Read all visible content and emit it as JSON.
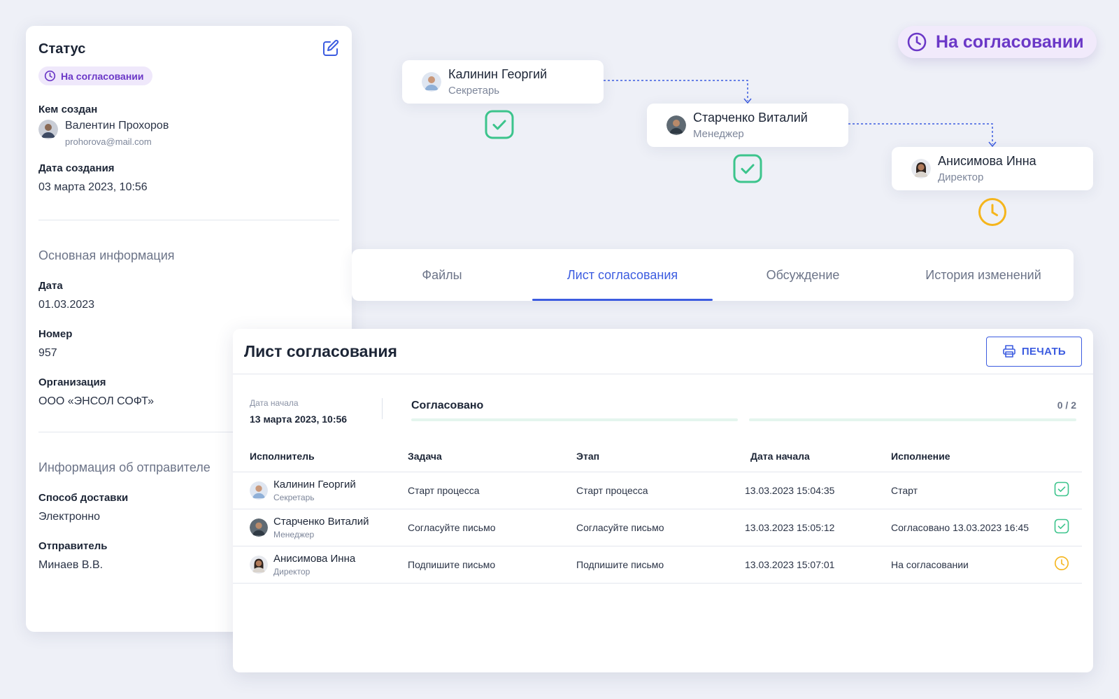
{
  "info": {
    "title": "Статус",
    "status_badge": "На согласовании",
    "created_by_label": "Кем создан",
    "creator_name": "Валентин Прохоров",
    "creator_email": "prohorova@mail.com",
    "created_date_label": "Дата создания",
    "created_date": "03 марта 2023, 10:56",
    "main_section": "Основная информация",
    "date_label": "Дата",
    "date": "01.03.2023",
    "number_label": "Номер",
    "number": "957",
    "org_label": "Организация",
    "org": "ООО «ЭНСОЛ СОФТ»",
    "sender_section": "Информация об отправителе",
    "delivery_label": "Способ доставки",
    "delivery": "Электронно",
    "sender_label": "Отправитель",
    "sender": "Минаев В.В."
  },
  "status_pill": "На согласовании",
  "workflow": [
    {
      "name": "Калинин Георгий",
      "role": "Секретарь",
      "state": "done"
    },
    {
      "name": "Старченко Виталий",
      "role": "Менеджер",
      "state": "done"
    },
    {
      "name": "Анисимова Инна",
      "role": "Директор",
      "state": "pending"
    }
  ],
  "tabs": [
    "Файлы",
    "Лист согласования",
    "Обсуждение",
    "История изменений"
  ],
  "active_tab": "Лист согласования",
  "sheet": {
    "title": "Лист согласования",
    "print_label": "ПЕЧАТЬ",
    "start_date_label": "Дата начала",
    "start_date": "13 марта 2023, 10:56",
    "approved_label": "Согласовано",
    "approved_count": "0 / 2",
    "columns": [
      "Исполнитель",
      "Задача",
      "Этап",
      "Дата начала",
      "Исполнение"
    ],
    "rows": [
      {
        "name": "Калинин Георгий",
        "role": "Секретарь",
        "task": "Старт процесса",
        "stage": "Старт процесса",
        "date": "13.03.2023  15:04:35",
        "result": "Старт",
        "state": "done"
      },
      {
        "name": "Старченко Виталий",
        "role": "Менеджер",
        "task": "Согласуйте письмо",
        "stage": "Согласуйте письмо",
        "date": "13.03.2023  15:05:12",
        "result": "Согласовано 13.03.2023 16:45",
        "state": "done"
      },
      {
        "name": "Анисимова Инна",
        "role": "Директор",
        "task": "Подпишите письмо",
        "stage": "Подпишите письмо",
        "date": "13.03.2023  15:07:01",
        "result": "На согласовании",
        "state": "pending"
      }
    ]
  },
  "colors": {
    "accent": "#3c5ce0",
    "purple": "#6b38c7",
    "success": "#3cc48c",
    "pending": "#f5b51c"
  }
}
